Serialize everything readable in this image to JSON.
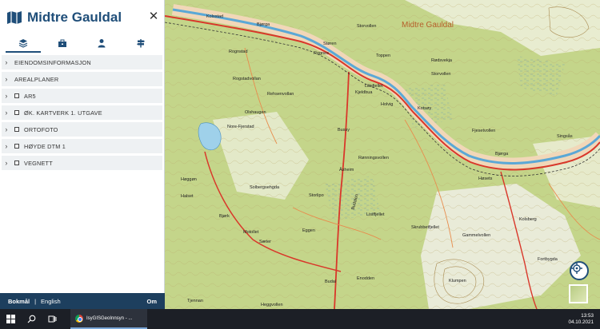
{
  "app": {
    "title": "Midtre Gauldal",
    "close_glyph": "✕",
    "collapse_glyph": "⇤"
  },
  "tabs": [
    {
      "name": "layers",
      "icon": "layers-icon"
    },
    {
      "name": "tools",
      "icon": "toolbox-icon"
    },
    {
      "name": "user",
      "icon": "user-icon"
    },
    {
      "name": "signpost",
      "icon": "signpost-icon"
    }
  ],
  "layers": [
    {
      "label": "EIENDOMSINFORMASJON",
      "checkbox": false
    },
    {
      "label": "AREALPLANER",
      "checkbox": false
    },
    {
      "label": "AR5",
      "checkbox": true
    },
    {
      "label": "ØK. KARTVERK 1. UTGAVE",
      "checkbox": true
    },
    {
      "label": "ORTOFOTO",
      "checkbox": true
    },
    {
      "label": "HØYDE DTM 1",
      "checkbox": true
    },
    {
      "label": "VEGNETT",
      "checkbox": true
    }
  ],
  "language": {
    "bokmal": "Bokmål",
    "separator": "|",
    "english": "English",
    "about": "Om"
  },
  "map": {
    "region_label": "Midtre Gauldal",
    "place_names": [
      "Kolsstad",
      "Bjørga",
      "Støren",
      "Storvollen",
      "Rognes",
      "Toppen",
      "Rognstad",
      "Rogstadvollan",
      "Kjeldbua",
      "Rødsvekja",
      "Storvollen",
      "Rehsenvollan",
      "Holvig",
      "Kotsøy",
      "Olshaugen",
      "Nore-Fjerstad",
      "Fjesetvollen",
      "Singsås",
      "Bjørga",
      "Høggøn",
      "Bussy",
      "Rønningsvollen",
      "Åsheim",
      "Storlipo",
      "Lisiffjellet",
      "Høsets",
      "Solbergsehgda",
      "Bjørk",
      "Motollet",
      "Sæter",
      "Skrubbetfjellet",
      "Gammelvollen",
      "Klumpen",
      "Kolsberg",
      "Fortbygda",
      "Enodden",
      "Tjennan",
      "Heggvollen",
      "Eggen",
      "Budalen",
      "Halset",
      "Budal",
      "Lillefjellet"
    ]
  },
  "taskbar": {
    "app_label": "IsyGISGeoInnsyn - ...",
    "time": "13:53",
    "date": "04.10.2021"
  }
}
